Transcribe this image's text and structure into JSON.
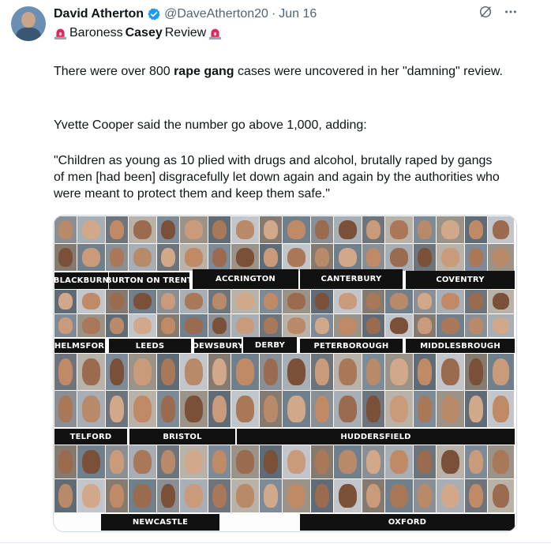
{
  "tweet": {
    "author_name": "David Atherton",
    "handle": "@DaveAtherton20",
    "separator": "·",
    "date": "Jun 16",
    "headline_prefix": "Baroness ",
    "headline_bold": "Casey",
    "headline_suffix": " Review",
    "p1_before": "There were over 800 ",
    "p1_bold": "rape gang",
    "p1_after": " cases were uncovered in her \"damning\" review.",
    "p2": "Yvette Cooper said the number go above 1,000, adding:",
    "p3": "\"Children as young as 10 plied with drugs and alcohol, brutally raped by gangs of men [had been] disgracefully let down again and again by the authorities who were meant to protect them and keep them safe.\""
  },
  "icons": {
    "verified": "verified-badge-icon",
    "grok": "grok-icon",
    "more": "more-icon",
    "siren": "police-siren-icon",
    "verified_color": "#1d9bf0"
  },
  "collage": {
    "labels": {
      "blackburn": "BLACKBURN",
      "burton": "BURTON ON TRENT",
      "accrington": "ACCRINGTON",
      "canterbury": "CANTERBURY",
      "coventry": "COVENTRY",
      "chelmsford": "CHELMSFORD",
      "leeds": "LEEDS",
      "dewsbury": "DEWSBURY",
      "derby": "DERBY",
      "peterborough": "PETERBOROUGH",
      "middlesbrough": "MIDDLESBROUGH",
      "telford": "TELFORD",
      "bristol": "BRISTOL",
      "huddersfield": "HUDDERSFIELD",
      "newcastle": "NEWCASTLE",
      "oxford": "OXFORD"
    }
  }
}
